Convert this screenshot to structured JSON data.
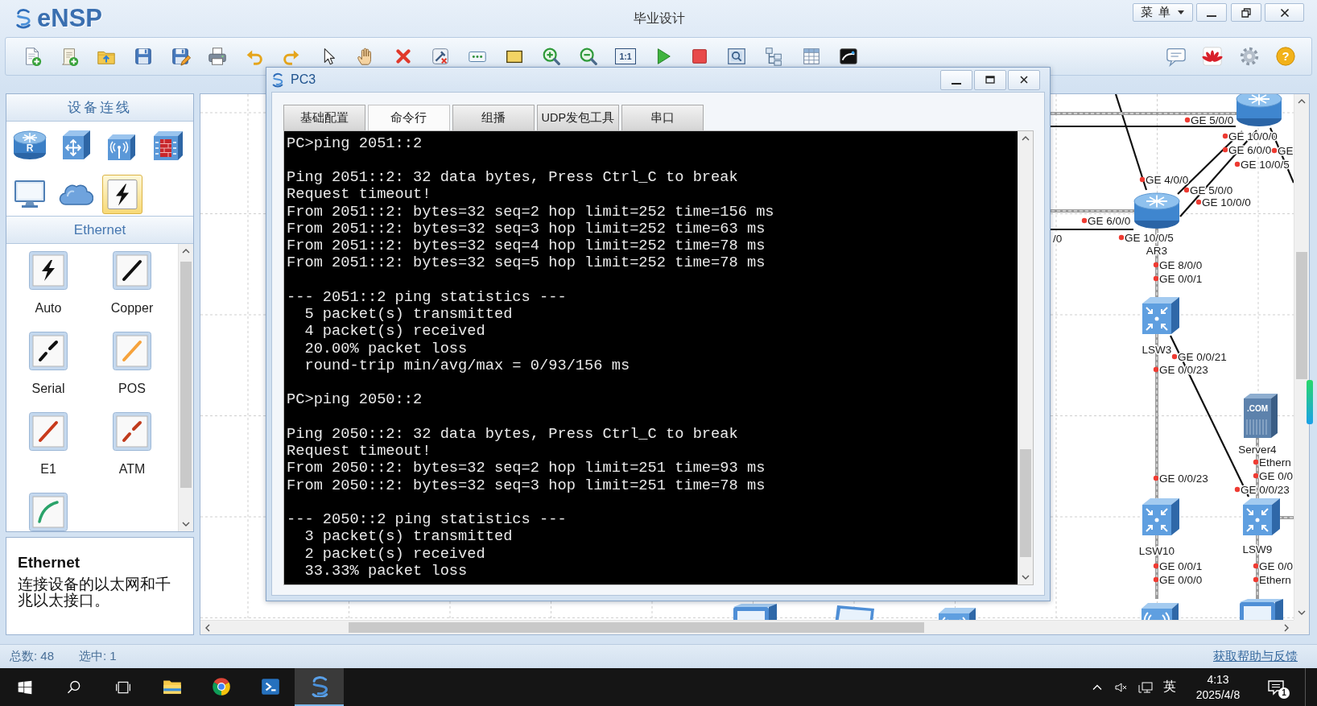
{
  "window": {
    "app_name": "eNSP",
    "title": "毕业设计",
    "menu_button": "菜单"
  },
  "toolbar": {
    "actual_size_label": "1:1",
    "help_glyph": "?"
  },
  "left_panel": {
    "title": "设备连线",
    "device_categories": [
      {
        "kind": "router",
        "glyph": "R",
        "selected": false
      },
      {
        "kind": "switch",
        "selected": false
      },
      {
        "kind": "wireless",
        "selected": false
      },
      {
        "kind": "firewall",
        "selected": false
      },
      {
        "kind": "monitor",
        "selected": false
      },
      {
        "kind": "cloud",
        "selected": false
      },
      {
        "kind": "cable",
        "selected": true
      }
    ],
    "section_title": "Ethernet",
    "cables": [
      {
        "kind": "auto",
        "label": "Auto"
      },
      {
        "kind": "copper",
        "label": "Copper"
      },
      {
        "kind": "serial",
        "label": "Serial"
      },
      {
        "kind": "pos",
        "label": "POS"
      },
      {
        "kind": "e1",
        "label": "E1"
      },
      {
        "kind": "atm",
        "label": "ATM"
      },
      {
        "kind": "curve"
      }
    ],
    "description": {
      "title": "Ethernet",
      "text": "连接设备的以太网和千兆以太接口。"
    }
  },
  "canvas": {
    "devices": [
      {
        "kind": "router"
      },
      {
        "kind": "router",
        "name": "AR3"
      },
      {
        "kind": "switch",
        "name": "LSW3"
      },
      {
        "kind": "server",
        "name": "Server4",
        "glyph": ".COM"
      },
      {
        "kind": "switch",
        "name": "LSW10"
      },
      {
        "kind": "switch",
        "name": "LSW9"
      },
      {
        "kind": "wireless"
      },
      {
        "kind": "client"
      },
      {
        "kind": "client"
      },
      {
        "kind": "pc"
      },
      {
        "kind": "wireless"
      }
    ],
    "links": [
      {
        "kind": "solid"
      },
      {
        "kind": "solid"
      },
      {
        "kind": "solid"
      },
      {
        "kind": "solid"
      },
      {
        "kind": "solid"
      },
      {
        "kind": "solid"
      },
      {
        "kind": "solid"
      },
      {
        "kind": "striped"
      },
      {
        "kind": "striped"
      },
      {
        "kind": "striped"
      },
      {
        "kind": "striped"
      },
      {
        "kind": "striped"
      },
      {
        "kind": "striped"
      },
      {
        "kind": "striped"
      },
      {
        "kind": "striped"
      }
    ],
    "ports": [
      "GE 5/0/0",
      "GE 10/0/0",
      "GE 6/0/0",
      "GE",
      "GE 10/0/5",
      "GE 4/0/0",
      "GE 5/0/0",
      "GE 10/0/0",
      "GE 6/0/0",
      "/0",
      "GE 10/0/5",
      "GE 8/0/0",
      "GE 0/0/1",
      "GE 0/0/21",
      "GE 0/0/23",
      "Ethern",
      "GE 0/0",
      "GE 0/0/23",
      "GE 0/0/23",
      "GE 0/0/1",
      "GE 0/0/0",
      "GE 0/0",
      "Ethern"
    ]
  },
  "pc_window": {
    "title": "PC3",
    "tabs": [
      {
        "label": "基础配置",
        "selected": false
      },
      {
        "label": "命令行",
        "selected": true
      },
      {
        "label": "组播",
        "selected": false
      },
      {
        "label": "UDP发包工具",
        "selected": false
      },
      {
        "label": "串口",
        "selected": false
      }
    ],
    "terminal": [
      [
        "PC>ping 2051::2"
      ],
      [
        "Ping 2051::2: 32 data bytes, Press Ctrl_C to break",
        "Request timeout!",
        "From 2051::2: bytes=32 seq=2 hop limit=252 time=156 ms",
        "From 2051::2: bytes=32 seq=3 hop limit=252 time=63 ms",
        "From 2051::2: bytes=32 seq=4 hop limit=252 time=78 ms",
        "From 2051::2: bytes=32 seq=5 hop limit=252 time=78 ms"
      ],
      [
        "--- 2051::2 ping statistics ---",
        "  5 packet(s) transmitted",
        "  4 packet(s) received",
        "  20.00% packet loss",
        "  round-trip min/avg/max = 0/93/156 ms"
      ],
      [
        "PC>ping 2050::2"
      ],
      [
        "Ping 2050::2: 32 data bytes, Press Ctrl_C to break",
        "Request timeout!",
        "From 2050::2: bytes=32 seq=2 hop limit=251 time=93 ms",
        "From 2050::2: bytes=32 seq=3 hop limit=251 time=78 ms"
      ],
      [
        "--- 2050::2 ping statistics ---",
        "  3 packet(s) transmitted",
        "  2 packet(s) received",
        "  33.33% packet loss"
      ]
    ]
  },
  "status_bar": {
    "total": "总数: 48",
    "selected": "选中: 1",
    "help_link": "获取帮助与反馈"
  },
  "taskbar": {
    "apps": [
      {
        "kind": "files",
        "active": false
      },
      {
        "kind": "browser",
        "active": false
      },
      {
        "kind": "powershell",
        "active": false
      },
      {
        "kind": "ensp",
        "active": true
      }
    ],
    "input_method": "英",
    "time": "4:13",
    "date": "2025/4/8",
    "notification_count": "1"
  }
}
